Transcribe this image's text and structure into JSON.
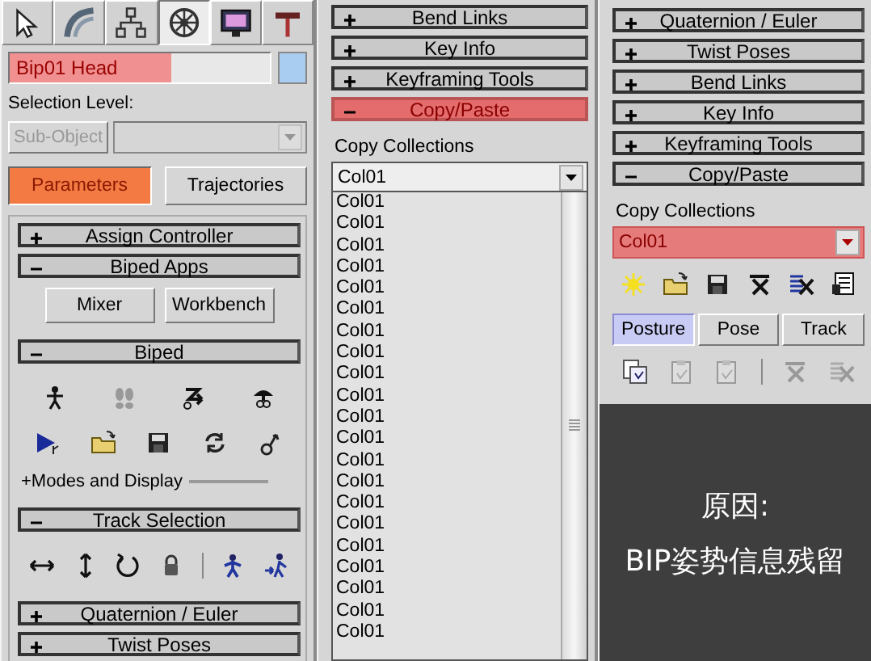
{
  "left_panel": {
    "command_tabs": [
      {
        "kind": "create",
        "selected": false
      },
      {
        "kind": "modify",
        "selected": false
      },
      {
        "kind": "hierarchy",
        "selected": false
      },
      {
        "kind": "motion",
        "selected": true
      },
      {
        "kind": "display",
        "selected": false
      },
      {
        "kind": "utilities",
        "selected": false
      }
    ],
    "object_name": {
      "value": "Bip01 Head",
      "highlighted": true
    },
    "selection_level_label": "Selection Level:",
    "sub_object_button": {
      "label": "Sub-Object",
      "disabled": true
    },
    "selection_dropdown": {
      "disabled": true
    },
    "mode_buttons": [
      {
        "label": "Parameters",
        "selected": true,
        "highlighted": true
      },
      {
        "label": "Trajectories",
        "selected": false,
        "highlighted": false
      }
    ],
    "rollouts": [
      {
        "title": "Assign Controller",
        "expanded": false
      },
      {
        "title": "Biped Apps",
        "expanded": true,
        "kind": "apps",
        "buttons": [
          "Mixer",
          "Workbench"
        ]
      },
      {
        "title": "Biped",
        "expanded": true,
        "kind": "biped",
        "footer": "+Modes and Display"
      },
      {
        "title": "Track Selection",
        "expanded": true,
        "kind": "track"
      },
      {
        "title": "Quaternion / Euler",
        "expanded": false
      },
      {
        "title": "Twist Poses",
        "expanded": false
      }
    ]
  },
  "middle_panel": {
    "rollouts": [
      {
        "title": "Bend Links",
        "expanded": false,
        "highlighted": false
      },
      {
        "title": "Key Info",
        "expanded": false,
        "highlighted": false
      },
      {
        "title": "Keyframing Tools",
        "expanded": false,
        "highlighted": false
      },
      {
        "title": "Copy/Paste",
        "expanded": true,
        "highlighted": true,
        "kind": "copy_list",
        "label": "Copy Collections",
        "value": "Col01",
        "open": true,
        "options": [
          "Col01",
          "Col01",
          "Col01",
          "Col01",
          "Col01",
          "Col01",
          "Col01",
          "Col01",
          "Col01",
          "Col01",
          "Col01",
          "Col01",
          "Col01",
          "Col01",
          "Col01",
          "Col01",
          "Col01",
          "Col01",
          "Col01",
          "Col01",
          "Col01"
        ]
      }
    ]
  },
  "right_panel": {
    "rollouts": [
      {
        "title": "Quaternion / Euler",
        "expanded": false,
        "highlighted": false
      },
      {
        "title": "Twist Poses",
        "expanded": false,
        "highlighted": false
      },
      {
        "title": "Bend Links",
        "expanded": false,
        "highlighted": false
      },
      {
        "title": "Key Info",
        "expanded": false,
        "highlighted": false
      },
      {
        "title": "Keyframing Tools",
        "expanded": false,
        "highlighted": false
      },
      {
        "title": "Copy/Paste",
        "expanded": true,
        "highlighted": false,
        "kind": "copy_tools",
        "label": "Copy Collections",
        "value": "Col01",
        "value_highlighted": true,
        "tabs": [
          {
            "label": "Posture",
            "selected": true
          },
          {
            "label": "Pose",
            "selected": false
          },
          {
            "label": "Track",
            "selected": false
          }
        ]
      }
    ],
    "caption": {
      "lines": [
        "原因:",
        "BIP姿势信息残留"
      ]
    }
  }
}
